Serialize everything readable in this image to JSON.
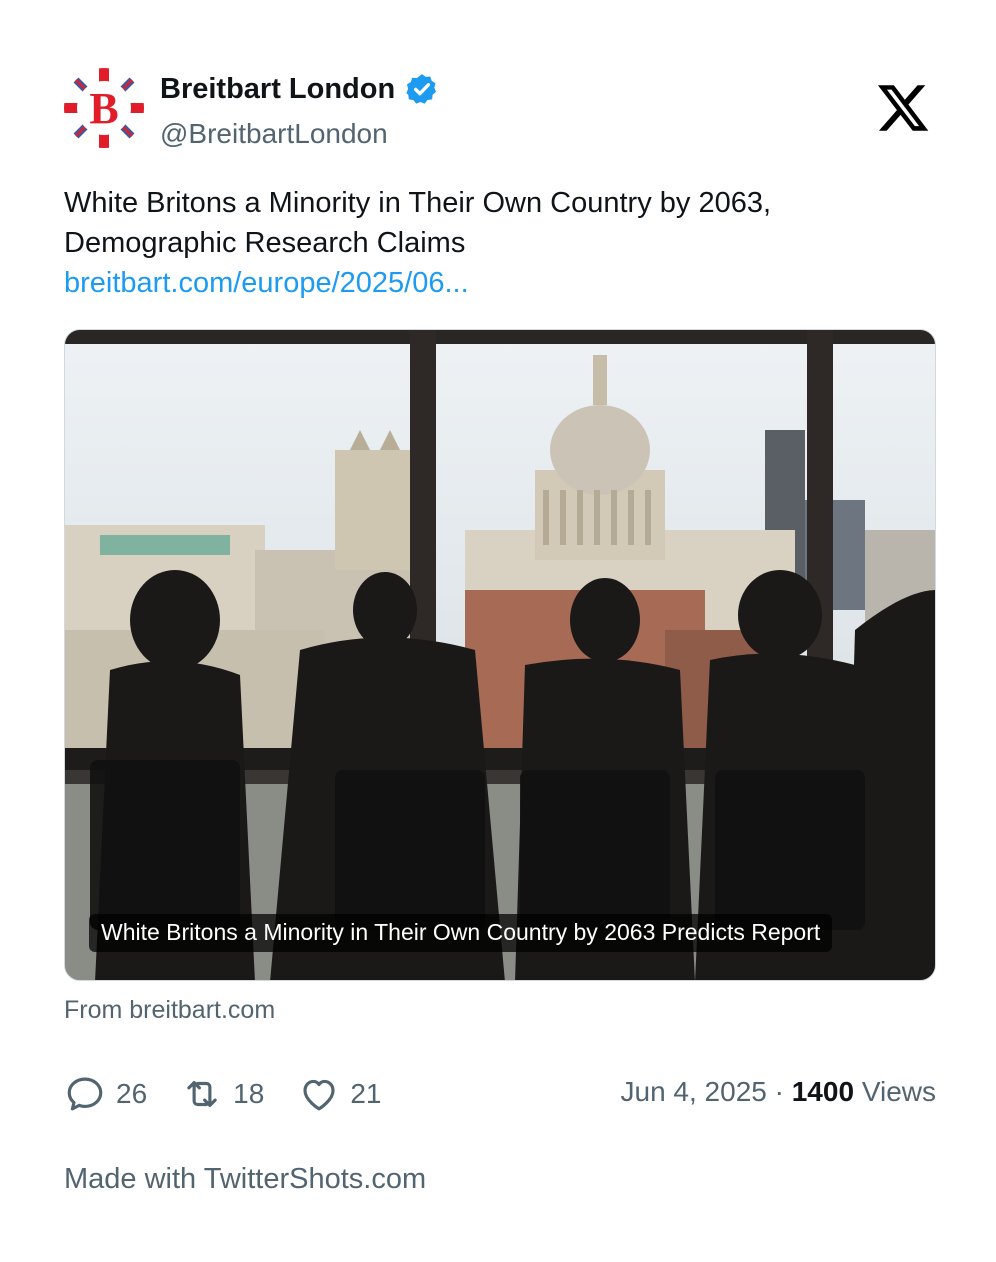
{
  "author": {
    "name": "Breitbart London",
    "handle": "@BreitbartLondon",
    "avatar_letter": "B",
    "verified": true
  },
  "tweet": {
    "text": "White Britons a Minority in Their Own Country by 2063, Demographic Research Claims",
    "link": "breitbart.com/europe/2025/06..."
  },
  "card": {
    "caption": "White Britons a Minority in Their Own Country by 2063 Predicts Report",
    "source": "From breitbart.com"
  },
  "stats": {
    "replies": "26",
    "retweets": "18",
    "likes": "21",
    "date": "Jun 4, 2025",
    "separator": "·",
    "views_count": "1400",
    "views_label": "Views"
  },
  "footer": {
    "text": "Made with TwitterShots.com"
  },
  "icons": {
    "verified": "verified-badge-icon",
    "platform": "x-logo-icon",
    "reply": "reply-icon",
    "retweet": "retweet-icon",
    "like": "heart-icon"
  },
  "colors": {
    "accent": "#1d9bf0",
    "muted": "#536471",
    "text": "#0f1419",
    "avatar_red": "#e11d2a",
    "avatar_blue": "#1f3a8a"
  }
}
